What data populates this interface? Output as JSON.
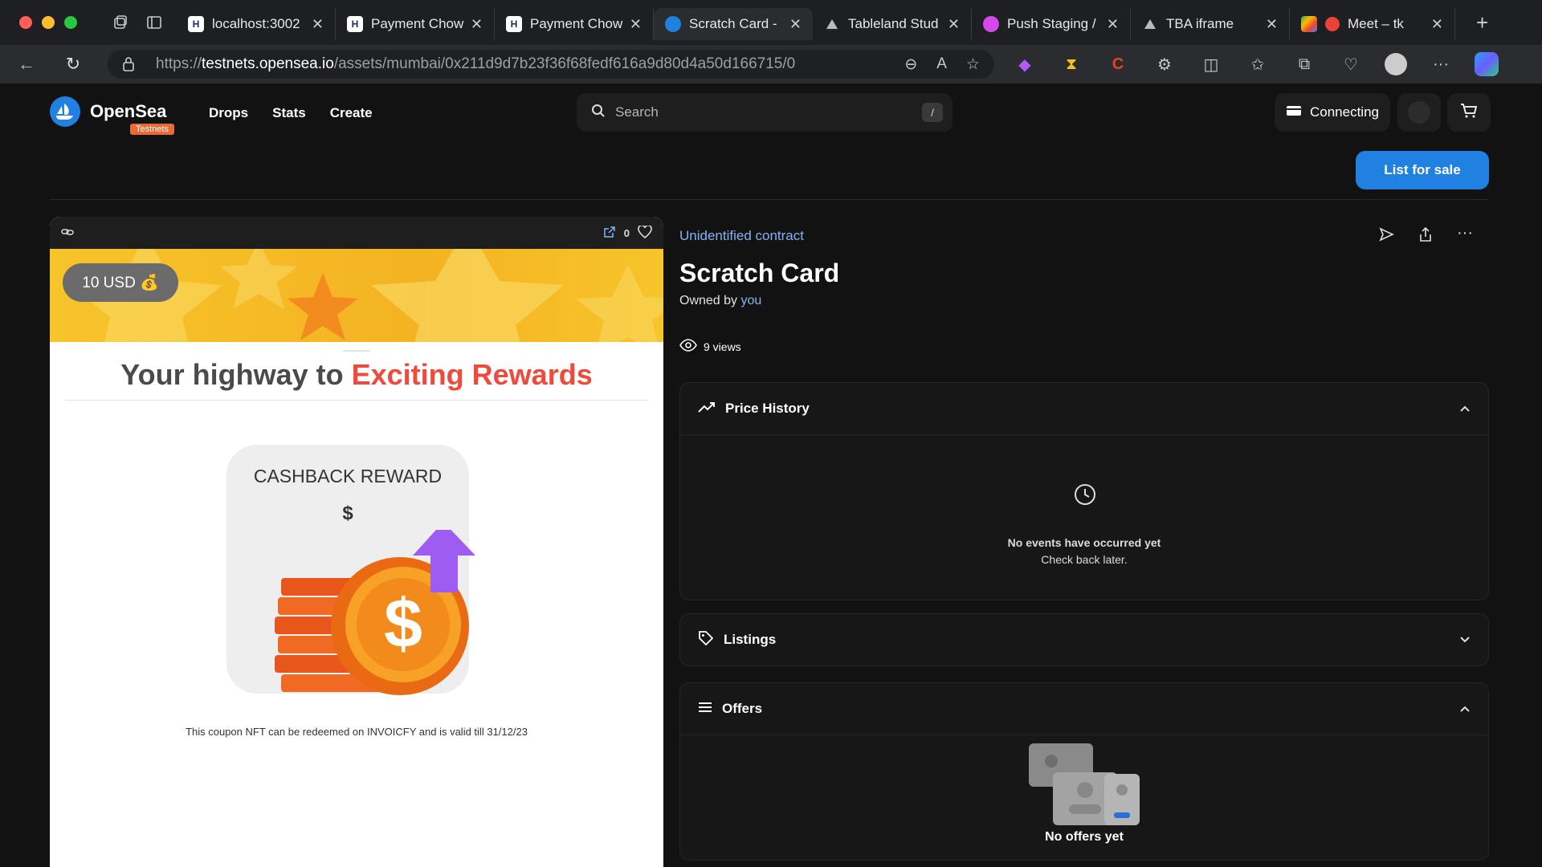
{
  "browser": {
    "tabs": [
      {
        "title": "localhost:3002",
        "icon": "hackmd-icon",
        "active": false
      },
      {
        "title": "Payment Chow",
        "icon": "hackmd-icon",
        "active": false
      },
      {
        "title": "Payment Chow",
        "icon": "hackmd-icon",
        "active": false
      },
      {
        "title": "Scratch Card -",
        "icon": "opensea-icon",
        "active": true
      },
      {
        "title": "Tableland Stud",
        "icon": "triangle-icon",
        "active": false
      },
      {
        "title": "Push Staging /",
        "icon": "push-icon",
        "active": false
      },
      {
        "title": "TBA iframe",
        "icon": "triangle-icon",
        "active": false
      },
      {
        "title": "Meet – tk",
        "icon": "meet-icon",
        "active": false
      }
    ],
    "url_prefix": "https://",
    "url_host": "testnets.opensea.io",
    "url_path": "/assets/mumbai/0x211d9d7b23f36f68fedf616a9d80d4a50d166715/0"
  },
  "header": {
    "brand": "OpenSea",
    "badge": "Testnets",
    "nav": [
      "Drops",
      "Stats",
      "Create"
    ],
    "search_placeholder": "Search",
    "search_shortcut": "/",
    "wallet_status": "Connecting",
    "list_for_sale": "List for sale"
  },
  "nft": {
    "favorites": "0",
    "price_pill": "10 USD 💰",
    "headline_a": "Your highway to ",
    "headline_b": "Exciting Rewards",
    "reward_title": "CASHBACK REWARD",
    "reward_symbol": "$",
    "redeem_text": "This coupon NFT can be redeemed on INVOICFY and is valid till 31/12/23"
  },
  "details": {
    "contract": "Unidentified contract",
    "title": "Scratch Card",
    "owned_prefix": "Owned by ",
    "owned_by": "you",
    "views": "9 views"
  },
  "panels": {
    "price_history": {
      "title": "Price History",
      "empty_1": "No events have occurred yet",
      "empty_2": "Check back later."
    },
    "listings": {
      "title": "Listings"
    },
    "offers": {
      "title": "Offers",
      "empty": "No offers yet"
    }
  },
  "colors": {
    "accent": "#2081e2",
    "link": "#82b4f8",
    "headline_red": "#ef4b3c",
    "badge": "#e86a35"
  }
}
